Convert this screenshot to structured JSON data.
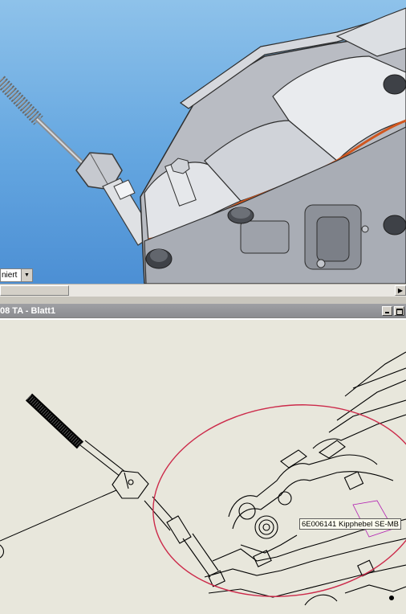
{
  "viewport3d": {
    "display_mode": "niert"
  },
  "drawing_window": {
    "title": "08 TA - Blatt1"
  },
  "tooltip": {
    "text": "6E006141 Kipphebel SE-MB"
  },
  "colors": {
    "viewport_sky": "#64a6e0",
    "part_grey": "#c9cbd0",
    "gasket_orange": "#d0561e",
    "drawing_background": "#e8e7dc",
    "detail_circle": "#cc2a4a",
    "titlebar_grey": "#8b8c90"
  }
}
